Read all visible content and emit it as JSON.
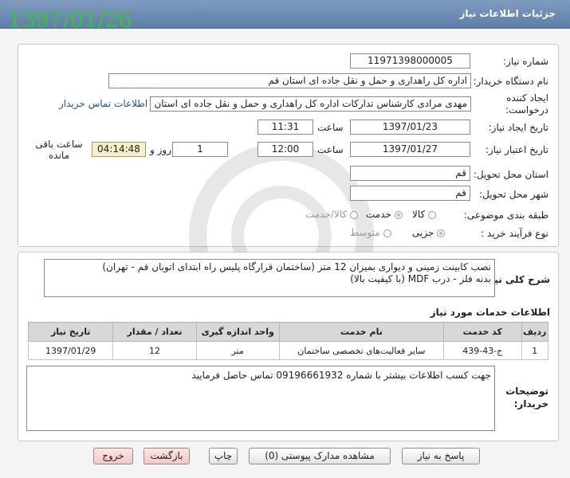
{
  "window": {
    "title": "جزئیات اطلاعات نیاز"
  },
  "overlay_date": "1397/01/26",
  "need": {
    "number_label": "شماره نیاز:",
    "number": "11971398000005",
    "buyer_label": "نام دستگاه خریدار:",
    "buyer": "اداره کل راهداری و حمل و نقل جاده ای استان قم",
    "creator_label": "ایجاد کننده درخواست:",
    "creator": "مهدی مرادی کارشناس تدارکات اداره کل راهداری و حمل و نقل جاده ای استان قم",
    "contact_link": "اطلاعات تماس خریدار",
    "created_date_label": "تاریخ ایجاد نیاز:",
    "created_date": "1397/01/23",
    "time_label": "ساعت",
    "created_time": "11:31",
    "validity_label": "تاریخ اعتبار نیاز:",
    "validity_date": "1397/01/27",
    "validity_time": "12:00",
    "days": "1",
    "day_and_label": "روز و",
    "remaining_time": "04:14:48",
    "remaining_label": "ساعت باقی مانده",
    "province_label": "استان محل تحویل:",
    "province": "قم",
    "city_label": "شهر محل تحویل:",
    "city": "قم",
    "category_label": "طبقه بندی موضوعی:",
    "category_options": [
      "کالا",
      "خدمت",
      "کالا/خدمت"
    ],
    "purchase_type_label": "نوع فرآیند خرید :",
    "purchase_options": [
      "جزیی",
      "متوسط"
    ]
  },
  "description": {
    "label": "شرح کلی نیاز:",
    "line1": "نصب کابینت زمینی و دیواری بمیزان 12 متر (ساختمان قرارگاه پلیس راه ابتدای اتوبان قم - تهران)",
    "line2": "بدنه فلز - درب MDF (با کیفیت بالا)"
  },
  "services": {
    "title": "اطلاعات خدمات مورد نیاز",
    "headers": [
      "ردیف",
      "کد خدمت",
      "نام خدمت",
      "واحد اندازه گیری",
      "تعداد / مقدار",
      "تاریخ نیاز"
    ],
    "rows": [
      [
        "1",
        "ج-43-439",
        "سایر فعالیت‌های تخصصی ساختمان",
        "متر",
        "12",
        "1397/01/29"
      ]
    ]
  },
  "buyer_notes": {
    "label": "توضیحات خریدار:",
    "text": "جهت کسب اطلاعات بیشتر با شماره 09196661932 تماس حاصل فرمایید"
  },
  "buttons": {
    "reply": "پاسخ به نیاز",
    "attachments": "مشاهده مدارک پیوستی (0)",
    "print": "چاپ",
    "back": "بازگشت",
    "exit": "خروج"
  },
  "colors": {
    "titlebar": "#6f8db4",
    "overlay_date": "#3cbf3c",
    "link": "#1d4fa8",
    "timer_bg": "#f6f0c9"
  }
}
